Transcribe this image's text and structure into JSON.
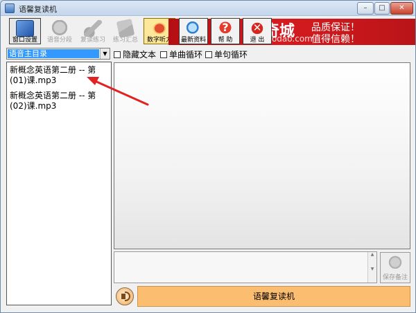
{
  "window": {
    "title": "语馨复读机",
    "controls": {
      "minimize": "–",
      "maximize": "□",
      "close": "✕"
    }
  },
  "toolbar": {
    "buttons": [
      {
        "label": "窗口设置",
        "icon": "window-settings-icon",
        "enabled": true
      },
      {
        "label": "语音分段",
        "icon": "segment-icon",
        "enabled": false
      },
      {
        "label": "复读练习",
        "icon": "repeat-practice-icon",
        "enabled": false
      },
      {
        "label": "练习汇总",
        "icon": "summary-icon",
        "enabled": false
      },
      {
        "label": "数字听力",
        "icon": "digital-listening-icon",
        "enabled": true
      },
      {
        "label": "最新资料",
        "icon": "latest-materials-icon",
        "enabled": true
      },
      {
        "label": "帮 助",
        "icon": "help-icon",
        "enabled": true
      },
      {
        "label": "退 出",
        "icon": "exit-icon",
        "enabled": true
      }
    ]
  },
  "banner": {
    "logo_text": "奇城",
    "url_text": "mantuodao.com",
    "slogan_line1": "品质保证！",
    "slogan_line2": "值得信赖！"
  },
  "directory": {
    "selected": "语音主目录"
  },
  "options": [
    {
      "label": "隐藏文本",
      "checked": false
    },
    {
      "label": "单曲循环",
      "checked": false
    },
    {
      "label": "单句循环",
      "checked": false
    }
  ],
  "playlist": {
    "items": [
      {
        "line1": "新概念英语第二册 -- 第",
        "line2": "(01)课.mp3"
      },
      {
        "line1": "新概念英语第二册 -- 第",
        "line2": "(02)课.mp3"
      }
    ]
  },
  "notes": {
    "save_label": "保存备注"
  },
  "player": {
    "name_label": "语馨复读机"
  },
  "colors": {
    "banner_red": "#c9161b",
    "name_bar": "#fbbd70",
    "selection_blue": "#3399ff",
    "annotation_arrow": "#e02222"
  }
}
